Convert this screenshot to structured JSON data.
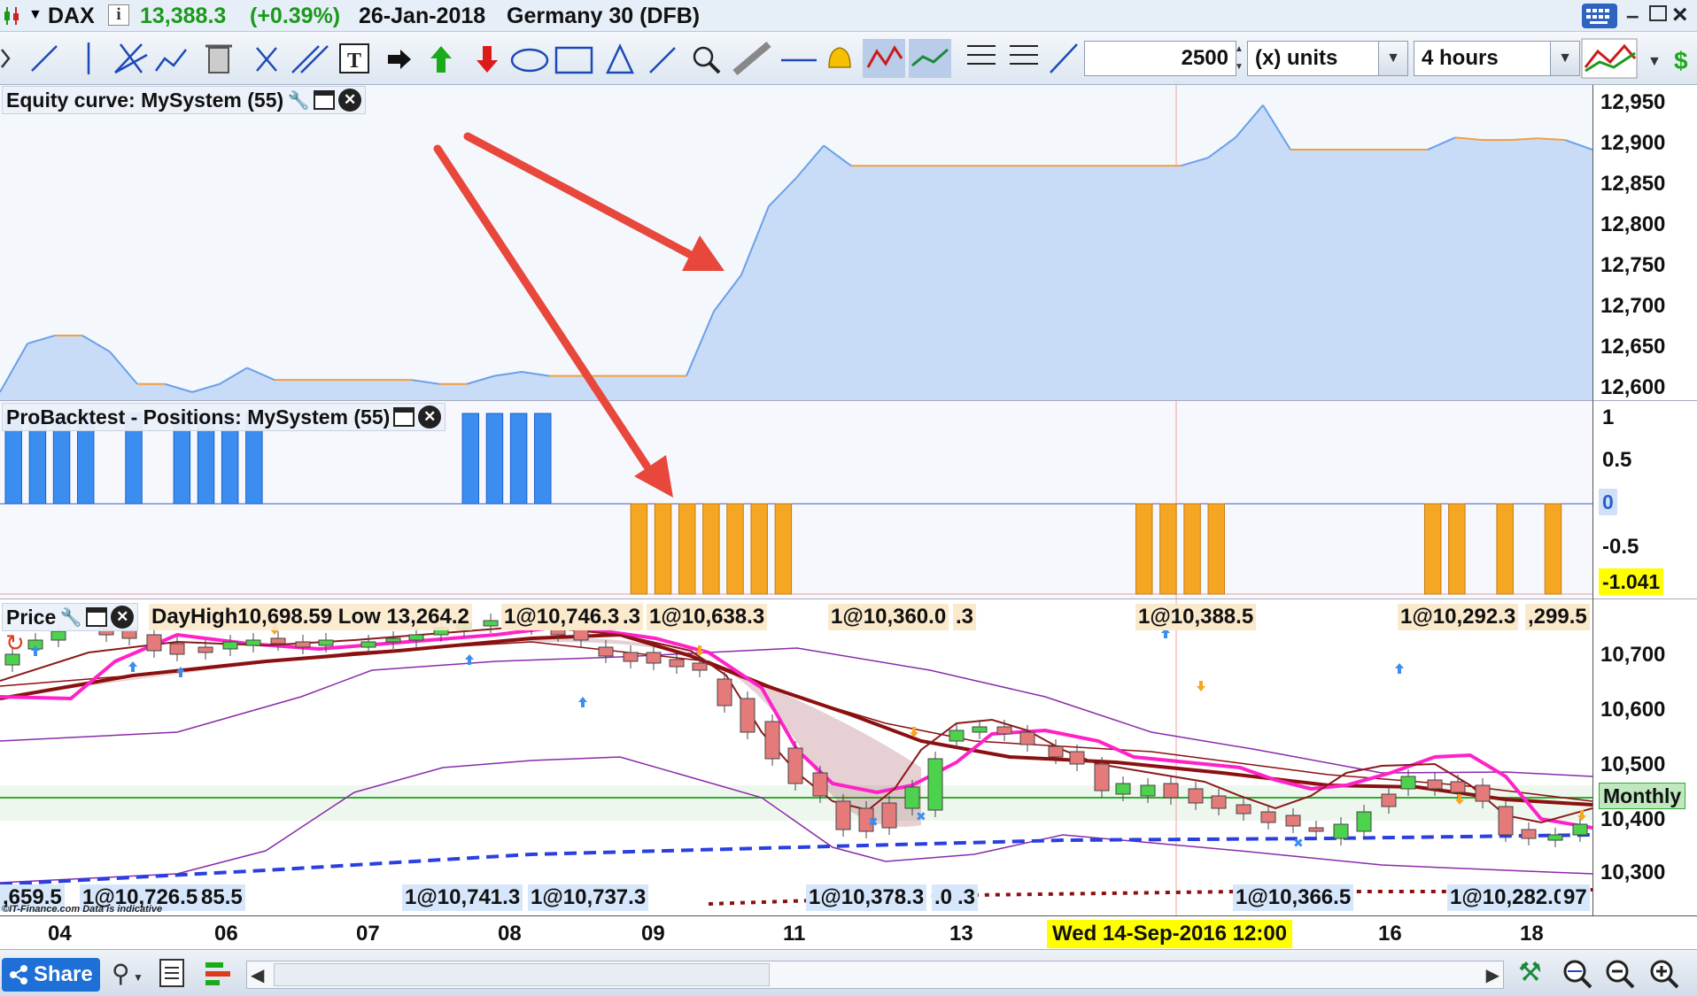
{
  "window": {
    "symbol": "DAX",
    "info_icon": "info-icon",
    "price": "13,388.3",
    "change": "(+0.39%)",
    "date": "26-Jan-2018",
    "instrument": "Germany 30 (DFB)"
  },
  "toolbar": {
    "quantity": "2500",
    "units": "(x) units",
    "timeframe": "4 hours"
  },
  "panes": {
    "equity": {
      "title": "Equity curve: MySystem (55)",
      "axis_labels": [
        "12,950",
        "12,900",
        "12,850",
        "12,800",
        "12,750",
        "12,700",
        "12,650",
        "12,600"
      ]
    },
    "positions": {
      "title": "ProBacktest - Positions: MySystem (55)",
      "axis_labels": [
        "1",
        "0.5",
        "0",
        "-0.5"
      ],
      "current_value": "-1.041"
    },
    "price": {
      "title": "Price",
      "overlay_text": "DayHigh10,698.59 Low 13,264.2",
      "axis_labels": [
        "10,700",
        "10,600",
        "10,500",
        "10,400",
        "10,300"
      ],
      "monthly_label": "Monthly",
      "top_annotations": [
        "1@10,746.3",
        ".3",
        "1@10,638.3",
        "1@10,360.0",
        ".3",
        "1@10,388.5",
        "1@10,292.3",
        ",299.5"
      ],
      "bottom_annotations": ",659.5",
      "bottom_list": [
        "1@10,726.5",
        "85.5",
        "1@10,741.3",
        "1@10,737.3",
        "1@10,378.3",
        ".0",
        ".3",
        "1@10,366.5",
        "1@10,282.0",
        "97"
      ],
      "watermark": "©IT-Finance.com Data is indicative"
    }
  },
  "time_axis": {
    "labels": [
      "04",
      "06",
      "07",
      "08",
      "09",
      "11",
      "13",
      "16",
      "18"
    ],
    "cursor": "Wed 14-Sep-2016 12:00"
  },
  "bottom": {
    "share_label": "Share"
  },
  "colors": {
    "long_bar": "#3b8ef0",
    "short_bar": "#f5a623",
    "equity_fill": "#c9dcf7",
    "equity_line": "#6aa0e8",
    "flat_line": "#f0a040",
    "arrow": "#e8473c",
    "magenta": "#ff22c8",
    "darkred": "#8b1010",
    "blue_dash": "#2a3fe0"
  },
  "chart_data": {
    "type": "line",
    "equity_y_range": [
      12590,
      12980
    ],
    "equity_points": [
      [
        0,
        12600
      ],
      [
        1,
        12660
      ],
      [
        2,
        12670
      ],
      [
        3,
        12670
      ],
      [
        4,
        12650
      ],
      [
        5,
        12610
      ],
      [
        6,
        12610
      ],
      [
        7,
        12600
      ],
      [
        8,
        12610
      ],
      [
        9,
        12630
      ],
      [
        10,
        12615
      ],
      [
        11,
        12615
      ],
      [
        12,
        12615
      ],
      [
        13,
        12615
      ],
      [
        14,
        12615
      ],
      [
        15,
        12615
      ],
      [
        16,
        12610
      ],
      [
        17,
        12610
      ],
      [
        18,
        12620
      ],
      [
        19,
        12625
      ],
      [
        20,
        12620
      ],
      [
        21,
        12620
      ],
      [
        22,
        12620
      ],
      [
        23,
        12620
      ],
      [
        24,
        12620
      ],
      [
        25,
        12620
      ],
      [
        26,
        12700
      ],
      [
        27,
        12745
      ],
      [
        28,
        12830
      ],
      [
        29,
        12865
      ],
      [
        30,
        12905
      ],
      [
        31,
        12880
      ],
      [
        32,
        12880
      ],
      [
        33,
        12880
      ],
      [
        34,
        12880
      ],
      [
        35,
        12880
      ],
      [
        36,
        12880
      ],
      [
        37,
        12880
      ],
      [
        38,
        12880
      ],
      [
        39,
        12880
      ],
      [
        40,
        12880
      ],
      [
        41,
        12880
      ],
      [
        42,
        12880
      ],
      [
        43,
        12880
      ],
      [
        44,
        12890
      ],
      [
        45,
        12915
      ],
      [
        46,
        12955
      ],
      [
        47,
        12900
      ],
      [
        48,
        12900
      ],
      [
        49,
        12900
      ],
      [
        50,
        12900
      ],
      [
        51,
        12900
      ],
      [
        52,
        12900
      ],
      [
        53,
        12915
      ],
      [
        54,
        12912
      ],
      [
        55,
        12912
      ],
      [
        56,
        12914
      ],
      [
        57,
        12912
      ],
      [
        58,
        12900
      ]
    ],
    "positions": [
      1,
      1,
      1,
      1,
      0,
      1,
      0,
      1,
      1,
      1,
      1,
      0,
      0,
      0,
      0,
      0,
      0,
      0,
      0,
      1,
      1,
      1,
      1,
      0,
      0,
      0,
      -1,
      -1,
      -1,
      -1,
      -1,
      -1,
      -1,
      0,
      0,
      0,
      0,
      0,
      0,
      0,
      0,
      0,
      0,
      0,
      0,
      0,
      0,
      -1,
      -1,
      -1,
      -1,
      0,
      0,
      0,
      0,
      0,
      0,
      0,
      0,
      -1,
      -1,
      0,
      -1,
      0,
      -1
    ]
  }
}
